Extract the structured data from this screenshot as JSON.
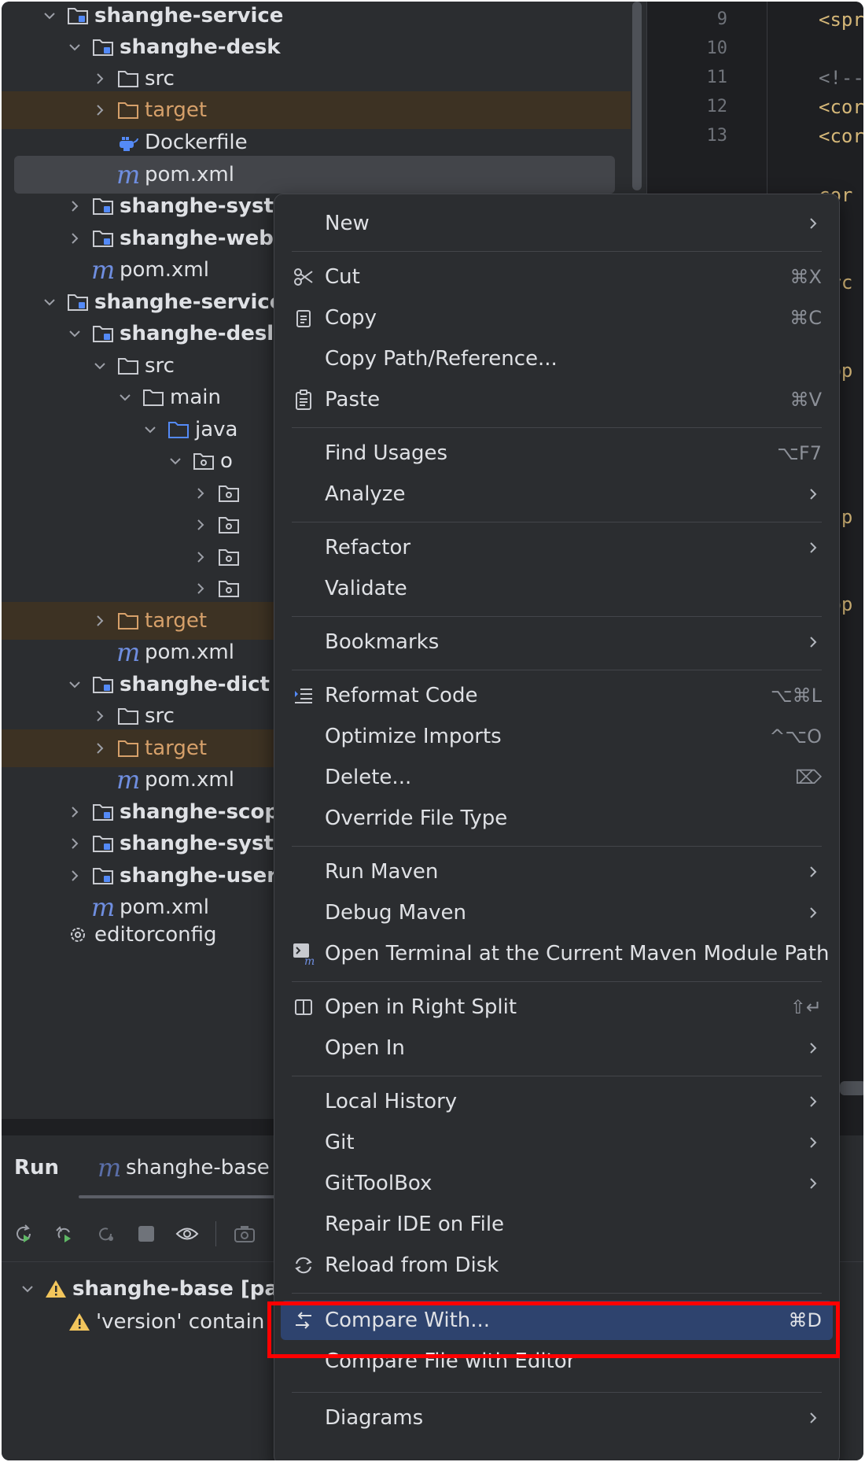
{
  "tree": {
    "rows": [
      {
        "label": "shanghe-service"
      },
      {
        "label": "shanghe-desk"
      },
      {
        "label": "src"
      },
      {
        "label": "target"
      },
      {
        "label": "Dockerfile"
      },
      {
        "label": "pom.xml"
      },
      {
        "label": "shanghe-syst"
      },
      {
        "label": "shanghe-web"
      },
      {
        "label": "pom.xml"
      },
      {
        "label": "shanghe-service"
      },
      {
        "label": "shanghe-desl"
      },
      {
        "label": "src"
      },
      {
        "label": "main"
      },
      {
        "label": "java"
      },
      {
        "label": "o"
      },
      {
        "label": "target"
      },
      {
        "label": "pom.xml"
      },
      {
        "label": "shanghe-dict"
      },
      {
        "label": "src"
      },
      {
        "label": "target"
      },
      {
        "label": "pom.xml"
      },
      {
        "label": "shanghe-scop"
      },
      {
        "label": "shanghe-syst"
      },
      {
        "label": "shanghe-user"
      },
      {
        "label": "pom.xml"
      },
      {
        "label": "editorconfig"
      }
    ]
  },
  "editor": {
    "line_numbers": [
      "9",
      "10",
      "11",
      "12",
      "13"
    ],
    "snippets": [
      "<spr",
      "<!--",
      "<cor",
      "<cor",
      "cor",
      "--",
      "orc",
      "--",
      "app",
      "/ap",
      "--",
      "app"
    ]
  },
  "run": {
    "title": "Run",
    "tab_label": "shanghe-base",
    "tree_item": "shanghe-base [pac",
    "warning": "'version' contain"
  },
  "menu": {
    "items": [
      {
        "label": "New",
        "shortcut": ""
      },
      {
        "label": "Cut",
        "shortcut": "⌘X"
      },
      {
        "label": "Copy",
        "shortcut": "⌘C"
      },
      {
        "label": "Copy Path/Reference...",
        "shortcut": ""
      },
      {
        "label": "Paste",
        "shortcut": "⌘V"
      },
      {
        "label": "Find Usages",
        "shortcut": "⌥F7"
      },
      {
        "label": "Analyze",
        "shortcut": ""
      },
      {
        "label": "Refactor",
        "shortcut": ""
      },
      {
        "label": "Validate",
        "shortcut": ""
      },
      {
        "label": "Bookmarks",
        "shortcut": ""
      },
      {
        "label": "Reformat Code",
        "shortcut": "⌥⌘L"
      },
      {
        "label": "Optimize Imports",
        "shortcut": "^⌥O"
      },
      {
        "label": "Delete...",
        "shortcut": "⌦"
      },
      {
        "label": "Override File Type",
        "shortcut": ""
      },
      {
        "label": "Run Maven",
        "shortcut": ""
      },
      {
        "label": "Debug Maven",
        "shortcut": ""
      },
      {
        "label": "Open Terminal at the Current Maven Module Path",
        "shortcut": ""
      },
      {
        "label": "Open in Right Split",
        "shortcut": "⇧↵"
      },
      {
        "label": "Open In",
        "shortcut": ""
      },
      {
        "label": "Local History",
        "shortcut": ""
      },
      {
        "label": "Git",
        "shortcut": ""
      },
      {
        "label": "GitToolBox",
        "shortcut": ""
      },
      {
        "label": "Repair IDE on File",
        "shortcut": ""
      },
      {
        "label": "Reload from Disk",
        "shortcut": ""
      },
      {
        "label": "Compare With...",
        "shortcut": "⌘D"
      },
      {
        "label": "Compare File with Editor",
        "shortcut": ""
      },
      {
        "label": "Diagrams",
        "shortcut": ""
      }
    ]
  },
  "colors": {
    "highlight": "#2e436e",
    "target_folder": "#d6a06a",
    "annotation": "#ff0000",
    "maven": "#6f8ee0"
  }
}
